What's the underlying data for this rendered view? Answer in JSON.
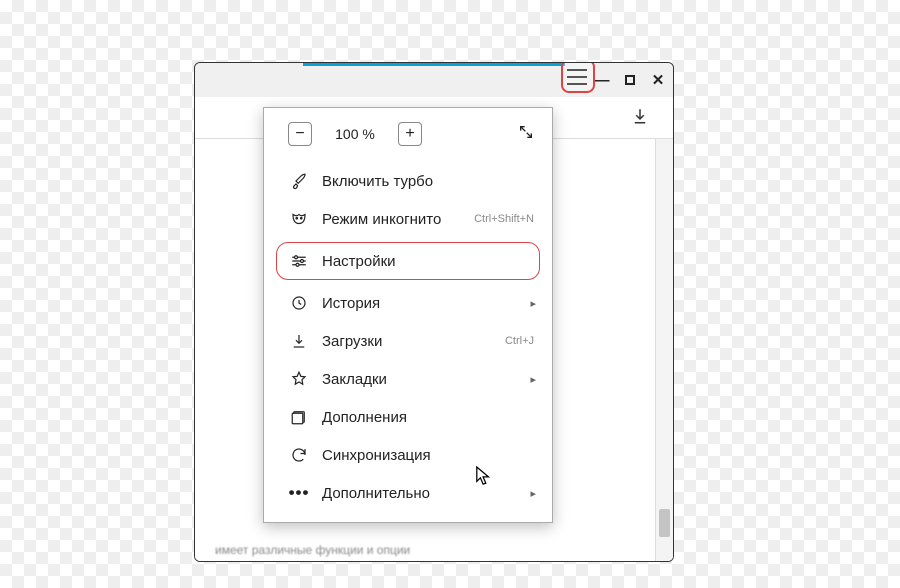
{
  "window": {
    "download_icon": "↓"
  },
  "menu": {
    "zoom": {
      "minus": "−",
      "plus": "+",
      "level": "100 %"
    },
    "items": [
      {
        "icon": "rocket",
        "label": "Включить турбо",
        "shortcut": "",
        "submenu": false
      },
      {
        "icon": "mask",
        "label": "Режим инкогнито",
        "shortcut": "Ctrl+Shift+N",
        "submenu": false
      },
      {
        "icon": "sliders",
        "label": "Настройки",
        "shortcut": "",
        "submenu": false,
        "highlighted": true
      },
      {
        "icon": "history",
        "label": "История",
        "shortcut": "",
        "submenu": true
      },
      {
        "icon": "download",
        "label": "Загрузки",
        "shortcut": "Ctrl+J",
        "submenu": false
      },
      {
        "icon": "star",
        "label": "Закладки",
        "shortcut": "",
        "submenu": true
      },
      {
        "icon": "addons",
        "label": "Дополнения",
        "shortcut": "",
        "submenu": false
      },
      {
        "icon": "sync",
        "label": "Синхронизация",
        "shortcut": "",
        "submenu": false
      },
      {
        "icon": "more",
        "label": "Дополнительно",
        "shortcut": "",
        "submenu": true
      }
    ]
  },
  "page_text_fragment": "имеет различные функции и опции"
}
